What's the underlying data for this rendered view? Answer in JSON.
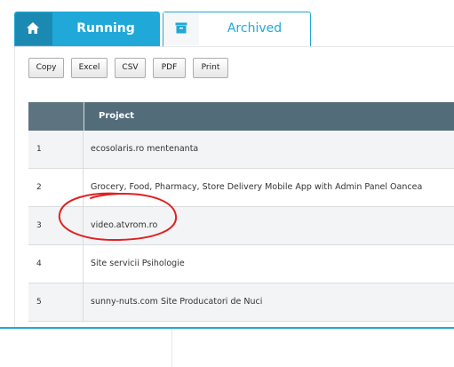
{
  "tabs": {
    "running": {
      "label": "Running",
      "icon": "home-icon"
    },
    "archived": {
      "label": "Archived",
      "icon": "archive-icon"
    }
  },
  "toolbar": {
    "buttons": [
      "Copy",
      "Excel",
      "CSV",
      "PDF",
      "Print"
    ]
  },
  "table": {
    "headers": [
      "",
      "Project"
    ],
    "rows": [
      {
        "num": "1",
        "project": "ecosolaris.ro mentenanta"
      },
      {
        "num": "2",
        "project": "Grocery, Food, Pharmacy, Store Delivery Mobile App with Admin Panel Oancea"
      },
      {
        "num": "3",
        "project": "video.atvrom.ro"
      },
      {
        "num": "4",
        "project": "Site servicii Psihologie"
      },
      {
        "num": "5",
        "project": "sunny-nuts.com Site Producatori de Nuci"
      }
    ]
  },
  "colors": {
    "accent": "#20a8d8",
    "table_header": "#536c79",
    "annotation": "#e02020"
  }
}
